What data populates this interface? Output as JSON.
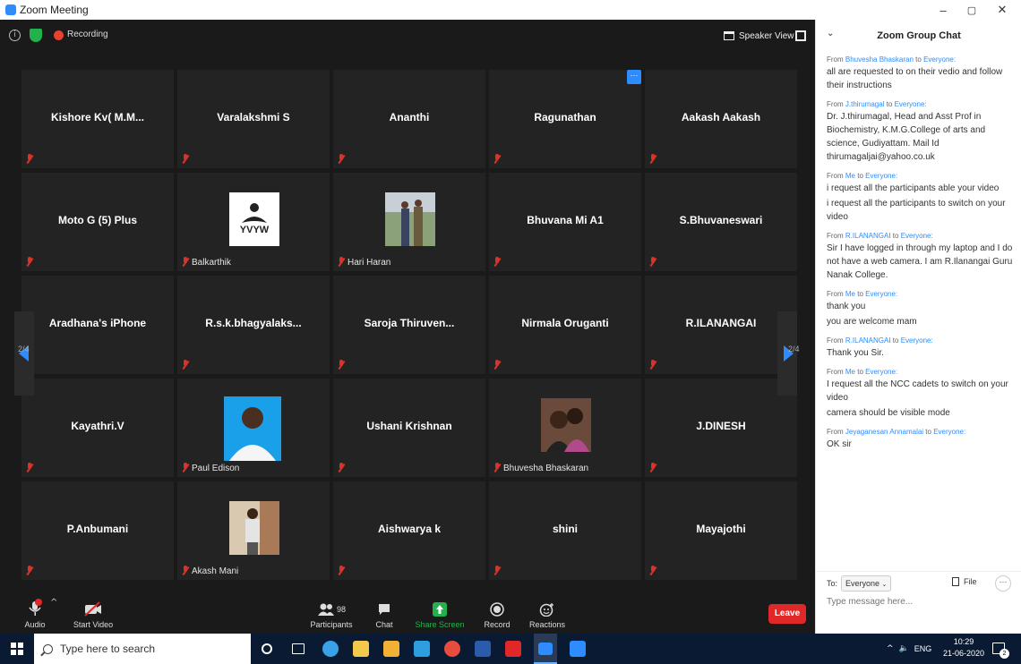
{
  "window": {
    "title": "Zoom Meeting",
    "min": "–",
    "max": "▢",
    "close": "✕"
  },
  "topbar": {
    "recording": "Recording",
    "view": "Speaker View"
  },
  "tiles": [
    {
      "name": "Kishore Kv( M.M...",
      "label": ""
    },
    {
      "name": "Varalakshmi S",
      "label": ""
    },
    {
      "name": "Ananthi",
      "label": ""
    },
    {
      "name": "Ragunathan",
      "label": ""
    },
    {
      "name": "Aakash Aakash",
      "label": ""
    },
    {
      "name": "Moto G (5) Plus",
      "label": ""
    },
    {
      "name": "",
      "label": "Balkarthik",
      "avatar": "yvyw",
      "avatar_text": "YVYW"
    },
    {
      "name": "",
      "label": "Hari Haran",
      "avatar": "photo2"
    },
    {
      "name": "Bhuvana Mi A1",
      "label": ""
    },
    {
      "name": "S.Bhuvaneswari",
      "label": ""
    },
    {
      "name": "Aradhana's iPhone",
      "label": ""
    },
    {
      "name": "R.s.k.bhagyalaks...",
      "label": ""
    },
    {
      "name": "Saroja  Thiruven...",
      "label": ""
    },
    {
      "name": "Nirmala Oruganti",
      "label": ""
    },
    {
      "name": "R.ILANANGAI",
      "label": ""
    },
    {
      "name": "Kayathri.V",
      "label": ""
    },
    {
      "name": "",
      "label": "Paul Edison",
      "avatar": "photo-blue"
    },
    {
      "name": "Ushani Krishnan",
      "label": ""
    },
    {
      "name": "",
      "label": "Bhuvesha Bhaskaran",
      "avatar": "photo-couple"
    },
    {
      "name": "J.DINESH",
      "label": ""
    },
    {
      "name": "P.Anbumani",
      "label": ""
    },
    {
      "name": "",
      "label": "Akash Mani",
      "avatar": "photo-man"
    },
    {
      "name": "Aishwarya k",
      "label": ""
    },
    {
      "name": "shini",
      "label": ""
    },
    {
      "name": "Mayajothi",
      "label": ""
    }
  ],
  "pager": {
    "left": "2/4",
    "right": "2/4"
  },
  "toolbar": {
    "audio": "Audio",
    "video": "Start Video",
    "participants": "Participants",
    "participants_count": "98",
    "chat": "Chat",
    "share": "Share Screen",
    "record": "Record",
    "reactions": "Reactions",
    "leave": "Leave"
  },
  "chat": {
    "title": "Zoom Group Chat",
    "messages": [
      {
        "from": "Bhuvesha Bhaskaran",
        "to": "Everyone",
        "lines": [
          "all are requested to on their vedio and follow their instructions"
        ]
      },
      {
        "from": "J.thirumagal",
        "to": "Everyone",
        "lines": [
          "Dr. J.thirumagal, Head and Asst Prof in Biochemistry, K.M.G.College of arts and science, Gudiyattam. Mail Id thirumagaljai@yahoo.co.uk"
        ]
      },
      {
        "from": "Me",
        "to": "Everyone",
        "lines": [
          "i request all the participants able your video",
          "i request all the participants to switch on your video"
        ]
      },
      {
        "from": "R.ILANANGAI",
        "to": "Everyone",
        "lines": [
          "Sir I have logged in through my laptop and I do not have a web camera. I am R.Ilanangai Guru Nanak College."
        ]
      },
      {
        "from": "Me",
        "to": "Everyone",
        "lines": [
          "thank you",
          "you are welcome mam"
        ]
      },
      {
        "from": "R.ILANANGAI",
        "to": "Everyone",
        "lines": [
          "Thank you Sir."
        ]
      },
      {
        "from": "Me",
        "to": "Everyone",
        "lines": [
          "I request all the NCC cadets to switch on your video",
          "camera should be visible mode"
        ]
      },
      {
        "from": "Jeyaganesan Annamalai",
        "to": "Everyone",
        "lines": [
          "OK sir"
        ]
      }
    ],
    "word_from": "From",
    "word_to": "to",
    "to_label": "To:",
    "to_value": "Everyone",
    "file": "File",
    "more": "···",
    "placeholder": "Type message here..."
  },
  "taskbar": {
    "search_placeholder": "Type here to search",
    "lang": "ENG",
    "time": "10:29",
    "date": "21-06-2020",
    "notifications": "2"
  }
}
